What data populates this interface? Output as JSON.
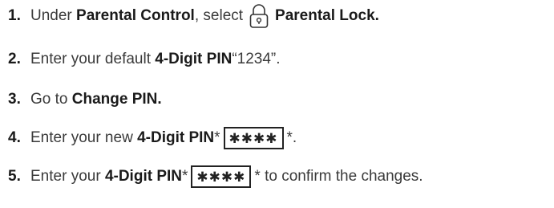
{
  "steps": [
    {
      "number": "1.",
      "t1": "Under ",
      "b1": "Parental Control",
      "t2": ", select ",
      "icon": "padlock-icon",
      "b2": "Parental Lock."
    },
    {
      "number": "2.",
      "t1": "Enter your default ",
      "b1": "4-Digit PIN",
      "t2": " “1234”."
    },
    {
      "number": "3.",
      "t1": "Go to ",
      "b1": "Change PIN."
    },
    {
      "number": "4.",
      "t1": "Enter your new ",
      "b1": "4-Digit PIN",
      "t2": " * ",
      "pin": "✱✱✱✱",
      "t3": " *."
    },
    {
      "number": "5.",
      "t1": "Enter your ",
      "b1": "4-Digit PIN",
      "t2": " * ",
      "pin": "✱✱✱✱",
      "t3": " * to confirm the changes."
    }
  ]
}
